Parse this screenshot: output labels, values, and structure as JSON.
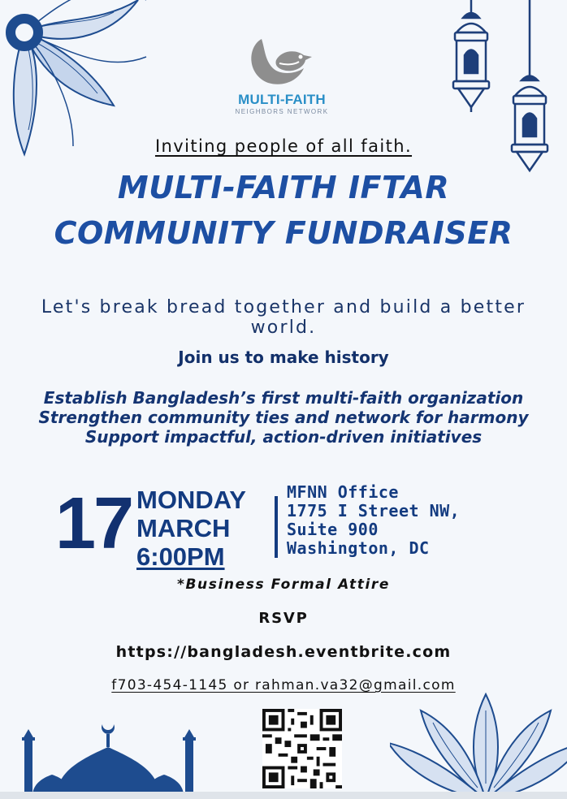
{
  "logo": {
    "title": "MULTI-FAITH",
    "subtitle": "NEIGHBORS NETWORK"
  },
  "invite_line": "Inviting people of all faith.",
  "title": {
    "line1": "MULTI-FAITH IFTAR",
    "line2": "COMMUNITY FUNDRAISER"
  },
  "tagline": "Let's break bread together and build a better world.",
  "join_line": "Join us to make history",
  "goals": [
    "Establish Bangladesh’s first multi-faith organization",
    "Strengthen community ties and network for harmony",
    "Support impactful, action-driven initiatives"
  ],
  "event": {
    "day_number": "17",
    "weekday": "MONDAY",
    "month": "MARCH",
    "time": "6:00PM"
  },
  "venue": {
    "line1": "MFNN Office",
    "line2": "1775 I Street NW,",
    "line3": "Suite 900",
    "line4": "Washington, DC"
  },
  "attire_note": "*Business Formal Attire",
  "rsvp_label": "RSVP",
  "rsvp_url": "https://bangladesh.eventbrite.com",
  "contact": "f703-454-1145 or rahman.va32@gmail.com",
  "colors": {
    "primary": "#1d4fa3",
    "navy": "#123170",
    "logo_blue": "#2a8fc7",
    "background": "#f4f7fb",
    "ornament": "#1e4c8f"
  },
  "icons": [
    "dove-crescent-icon",
    "lantern-icon",
    "mosque-icon",
    "mandala-icon",
    "qr-code-icon"
  ]
}
